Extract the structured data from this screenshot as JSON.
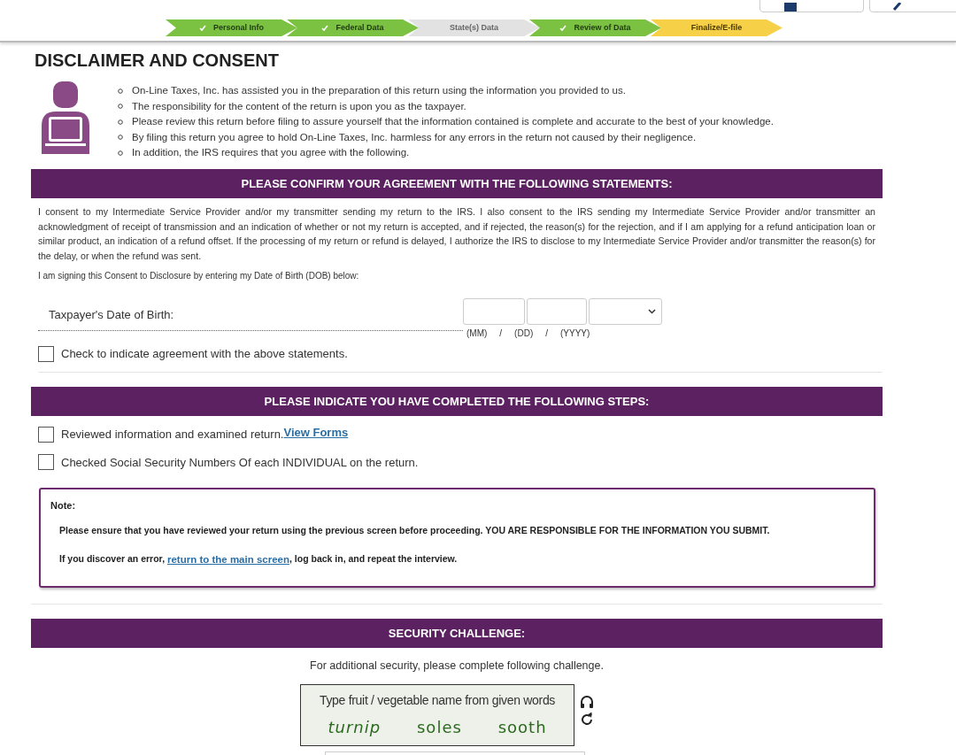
{
  "steps": [
    {
      "label": "Personal Info",
      "kind": "done"
    },
    {
      "label": "Federal Data",
      "kind": "done"
    },
    {
      "label": "State(s) Data",
      "kind": "skipped"
    },
    {
      "label": "Review of Data",
      "kind": "done"
    },
    {
      "label": "Finalize/E-file",
      "kind": "current"
    }
  ],
  "title": "DISCLAIMER AND CONSENT",
  "intro_bullets": [
    "On-Line Taxes, Inc. has assisted you in the preparation of this return using the information you provided to us.",
    "The responsibility for the content of the return is upon you as the taxpayer.",
    "Please review this return before filing to assure yourself that the information contained is complete and accurate to the best of your knowledge.",
    "By filing this return you agree to hold On-Line Taxes, Inc. harmless for any errors in the return not caused by their negligence.",
    "In addition, the IRS requires that you agree with the following."
  ],
  "agreement": {
    "heading": "PLEASE CONFIRM YOUR AGREEMENT WITH THE FOLLOWING STATEMENTS:",
    "consent_text": "I consent to my Intermediate Service Provider and/or my transmitter sending my return to the IRS. I also consent to the IRS sending my Intermediate Service Provider and/or transmitter an acknowledgment of receipt of transmission and an indication of whether or not my return is accepted, and if rejected, the reason(s) for the rejection, and if I am applying for a refund anticipation loan or similar product, an indication of a refund offset. If the processing of my return or refund is delayed, I authorize the IRS to disclose to my Intermediate Service Provider and/or transmitter the reason(s) for the delay, or when the refund was sent.",
    "signing_text": "I am signing this Consent to Disclosure by entering my Date of Birth (DOB) below:",
    "dob_label": "Taxpayer's Date of Birth:",
    "dob_hints": [
      "(MM)",
      "/",
      "(DD)",
      "/",
      "(YYYY)"
    ],
    "agree_checkbox": {
      "label": "Check to indicate agreement with the above statements.",
      "checked": false
    }
  },
  "steps_section": {
    "heading": "PLEASE INDICATE YOU HAVE COMPLETED THE FOLLOWING STEPS:",
    "checks": [
      {
        "label": "Reviewed information and examined return.",
        "link": "View Forms",
        "checked": false
      },
      {
        "label": "Checked Social Security Numbers Of each INDIVIDUAL on the return.",
        "checked": false
      }
    ]
  },
  "note": {
    "title": "Note:",
    "line1": "Please ensure that you have reviewed your return using the previous screen before proceeding. YOU ARE RESPONSIBLE FOR THE INFORMATION YOU SUBMIT.",
    "line2_before": "If you discover an error, ",
    "line2_link": "return to the main screen",
    "line2_after": ", log back in, and repeat the interview."
  },
  "security": {
    "heading": "SECURITY CHALLENGE:",
    "text": "For additional security, please complete following challenge.",
    "captcha_prompt": "Type fruit / vegetable name from given words",
    "captcha_words": [
      "turnip",
      "soles",
      "sooth"
    ]
  }
}
